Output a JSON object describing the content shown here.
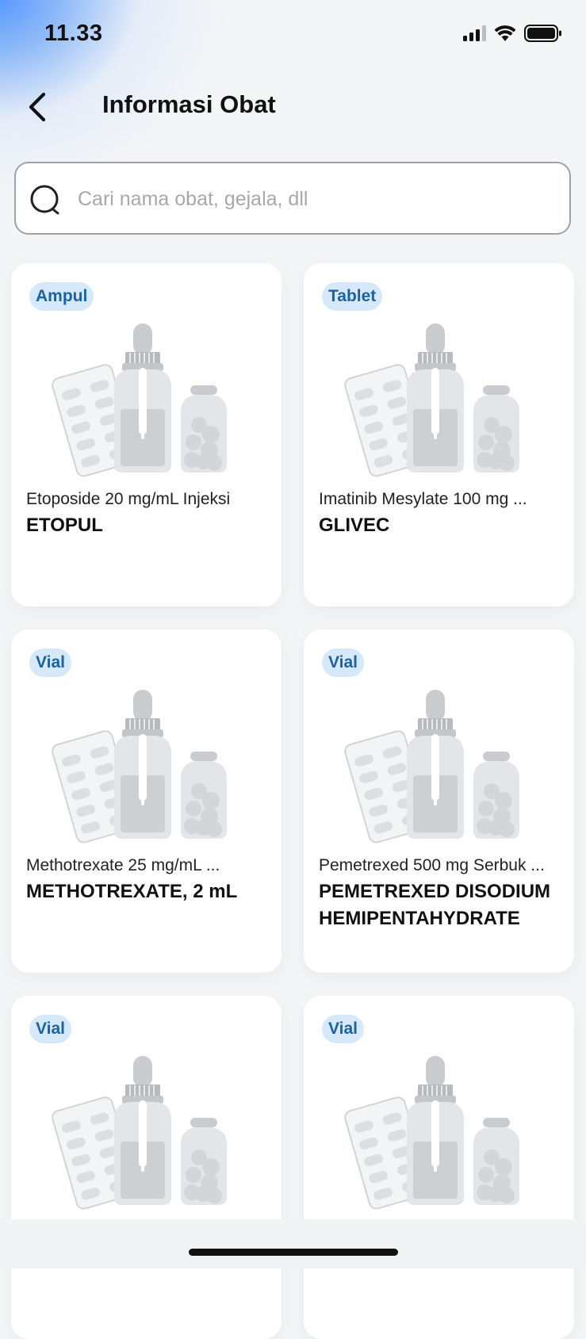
{
  "status_bar": {
    "time": "11.33"
  },
  "header": {
    "title": "Informasi Obat"
  },
  "search": {
    "placeholder": "Cari nama obat, gejala, dll",
    "value": ""
  },
  "colors": {
    "badge_bg": "#d5e9fb",
    "badge_text": "#1c62a3",
    "accent_glow": "#4f93ff"
  },
  "products": [
    {
      "badge": "Ampul",
      "generic": "Etoposide 20 mg/mL Injeksi",
      "brand": "ETOPUL",
      "icon": "medicine-illustration"
    },
    {
      "badge": "Tablet",
      "generic": "Imatinib Mesylate 100 mg ...",
      "brand": "GLIVEC",
      "icon": "medicine-illustration"
    },
    {
      "badge": "Vial",
      "generic": "Methotrexate 25 mg/mL ...",
      "brand": "METHOTREXATE, 2 mL",
      "icon": "medicine-illustration"
    },
    {
      "badge": "Vial",
      "generic": "Pemetrexed 500 mg Serbuk ...",
      "brand": "PEMETREXED DISODIUM HEMIPENTAHYDRATE",
      "icon": "medicine-illustration"
    },
    {
      "badge": "Vial",
      "generic": "",
      "brand": "",
      "icon": "medicine-illustration"
    },
    {
      "badge": "Vial",
      "generic": "",
      "brand": "",
      "icon": "medicine-illustration"
    }
  ]
}
